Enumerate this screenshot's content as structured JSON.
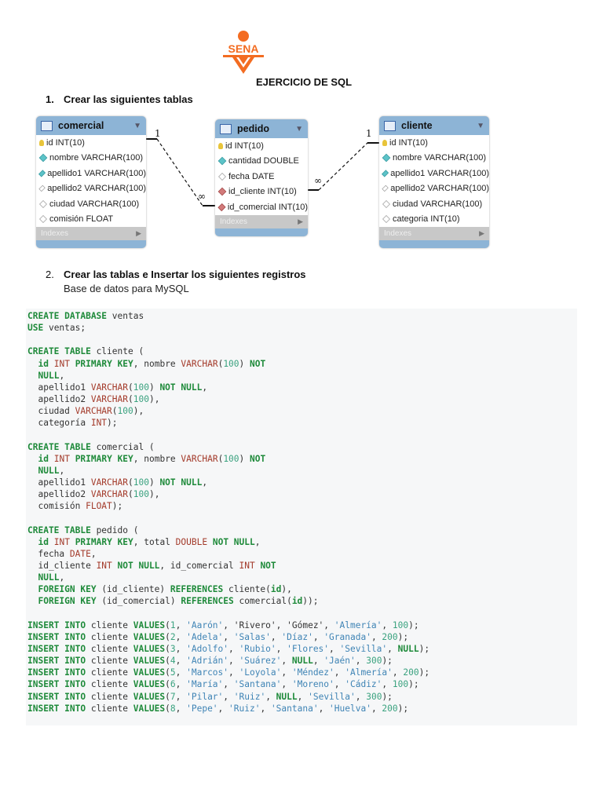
{
  "logo_text": "SENA",
  "title": "EJERCICIO DE SQL",
  "section1": {
    "num": "1.",
    "label": "Crear las siguientes tablas"
  },
  "section2": {
    "num": "2.",
    "label": "Crear las tablas e Insertar los siguientes registros",
    "subtitle": "Base de datos para MySQL"
  },
  "diagram": {
    "indexes_label": "Indexes",
    "one": "1",
    "many": "∞",
    "tables": [
      {
        "name": "comercial",
        "columns": [
          [
            "key",
            "id INT(10)"
          ],
          [
            "dia",
            "nombre VARCHAR(100)"
          ],
          [
            "dia",
            "apellido1 VARCHAR(100)"
          ],
          [
            "empty",
            "apellido2 VARCHAR(100)"
          ],
          [
            "empty",
            "ciudad VARCHAR(100)"
          ],
          [
            "empty",
            "comisión FLOAT"
          ]
        ]
      },
      {
        "name": "pedido",
        "columns": [
          [
            "key",
            "id INT(10)"
          ],
          [
            "dia",
            "cantidad DOUBLE"
          ],
          [
            "empty",
            "fecha DATE"
          ],
          [
            "fk",
            "id_cliente INT(10)"
          ],
          [
            "fk",
            "id_comercial INT(10)"
          ]
        ]
      },
      {
        "name": "cliente",
        "columns": [
          [
            "key",
            "id INT(10)"
          ],
          [
            "dia",
            "nombre VARCHAR(100)"
          ],
          [
            "dia",
            "apellido1 VARCHAR(100)"
          ],
          [
            "empty",
            "apellido2 VARCHAR(100)"
          ],
          [
            "empty",
            "ciudad VARCHAR(100)"
          ],
          [
            "empty",
            "categoria INT(10)"
          ]
        ]
      }
    ]
  },
  "code": [
    [
      [
        "k",
        "CREATE DATABASE"
      ],
      [
        "p",
        " ventas"
      ]
    ],
    [
      [
        "k",
        "USE"
      ],
      [
        "p",
        " ventas;"
      ]
    ],
    [],
    [
      [
        "k",
        "CREATE TABLE"
      ],
      [
        "p",
        " cliente ("
      ]
    ],
    [
      [
        "p",
        "  "
      ],
      [
        "k",
        "id"
      ],
      [
        "p",
        " "
      ],
      [
        "t",
        "INT"
      ],
      [
        "p",
        " "
      ],
      [
        "k",
        "PRIMARY KEY"
      ],
      [
        "p",
        ", nombre "
      ],
      [
        "t",
        "VARCHAR"
      ],
      [
        "p",
        "("
      ],
      [
        "n",
        "100"
      ],
      [
        "p",
        ") "
      ],
      [
        "k",
        "NOT"
      ]
    ],
    [
      [
        "p",
        "  "
      ],
      [
        "k",
        "NULL"
      ],
      [
        "p",
        ","
      ]
    ],
    [
      [
        "p",
        "  apellido1 "
      ],
      [
        "t",
        "VARCHAR"
      ],
      [
        "p",
        "("
      ],
      [
        "n",
        "100"
      ],
      [
        "p",
        ") "
      ],
      [
        "k",
        "NOT NULL"
      ],
      [
        "p",
        ","
      ]
    ],
    [
      [
        "p",
        "  apellido2 "
      ],
      [
        "t",
        "VARCHAR"
      ],
      [
        "p",
        "("
      ],
      [
        "n",
        "100"
      ],
      [
        "p",
        "),"
      ]
    ],
    [
      [
        "p",
        "  ciudad "
      ],
      [
        "t",
        "VARCHAR"
      ],
      [
        "p",
        "("
      ],
      [
        "n",
        "100"
      ],
      [
        "p",
        "),"
      ]
    ],
    [
      [
        "p",
        "  categoría "
      ],
      [
        "t",
        "INT"
      ],
      [
        "p",
        ");"
      ]
    ],
    [],
    [
      [
        "k",
        "CREATE TABLE"
      ],
      [
        "p",
        " comercial ("
      ]
    ],
    [
      [
        "p",
        "  "
      ],
      [
        "k",
        "id"
      ],
      [
        "p",
        " "
      ],
      [
        "t",
        "INT"
      ],
      [
        "p",
        " "
      ],
      [
        "k",
        "PRIMARY KEY"
      ],
      [
        "p",
        ", nombre "
      ],
      [
        "t",
        "VARCHAR"
      ],
      [
        "p",
        "("
      ],
      [
        "n",
        "100"
      ],
      [
        "p",
        ") "
      ],
      [
        "k",
        "NOT"
      ]
    ],
    [
      [
        "p",
        "  "
      ],
      [
        "k",
        "NULL"
      ],
      [
        "p",
        ","
      ]
    ],
    [
      [
        "p",
        "  apellido1 "
      ],
      [
        "t",
        "VARCHAR"
      ],
      [
        "p",
        "("
      ],
      [
        "n",
        "100"
      ],
      [
        "p",
        ") "
      ],
      [
        "k",
        "NOT NULL"
      ],
      [
        "p",
        ","
      ]
    ],
    [
      [
        "p",
        "  apellido2 "
      ],
      [
        "t",
        "VARCHAR"
      ],
      [
        "p",
        "("
      ],
      [
        "n",
        "100"
      ],
      [
        "p",
        "),"
      ]
    ],
    [
      [
        "p",
        "  comisión "
      ],
      [
        "t",
        "FLOAT"
      ],
      [
        "p",
        ");"
      ]
    ],
    [],
    [
      [
        "k",
        "CREATE TABLE"
      ],
      [
        "p",
        " pedido ("
      ]
    ],
    [
      [
        "p",
        "  "
      ],
      [
        "k",
        "id"
      ],
      [
        "p",
        " "
      ],
      [
        "t",
        "INT"
      ],
      [
        "p",
        " "
      ],
      [
        "k",
        "PRIMARY KEY"
      ],
      [
        "p",
        ", total "
      ],
      [
        "t",
        "DOUBLE"
      ],
      [
        "p",
        " "
      ],
      [
        "k",
        "NOT NULL"
      ],
      [
        "p",
        ","
      ]
    ],
    [
      [
        "p",
        "  fecha "
      ],
      [
        "t",
        "DATE"
      ],
      [
        "p",
        ","
      ]
    ],
    [
      [
        "p",
        "  id_cliente "
      ],
      [
        "t",
        "INT"
      ],
      [
        "p",
        " "
      ],
      [
        "k",
        "NOT NULL"
      ],
      [
        "p",
        ", id_comercial "
      ],
      [
        "t",
        "INT"
      ],
      [
        "p",
        " "
      ],
      [
        "k",
        "NOT"
      ]
    ],
    [
      [
        "p",
        "  "
      ],
      [
        "k",
        "NULL"
      ],
      [
        "p",
        ","
      ]
    ],
    [
      [
        "p",
        "  "
      ],
      [
        "k",
        "FOREIGN KEY"
      ],
      [
        "p",
        " (id_cliente) "
      ],
      [
        "k",
        "REFERENCES"
      ],
      [
        "p",
        " cliente("
      ],
      [
        "k",
        "id"
      ],
      [
        "p",
        "),"
      ]
    ],
    [
      [
        "p",
        "  "
      ],
      [
        "k",
        "FOREIGN KEY"
      ],
      [
        "p",
        " (id_comercial) "
      ],
      [
        "k",
        "REFERENCES"
      ],
      [
        "p",
        " comercial("
      ],
      [
        "k",
        "id"
      ],
      [
        "p",
        "));"
      ]
    ],
    [],
    [
      [
        "k",
        "INSERT INTO"
      ],
      [
        "p",
        " cliente "
      ],
      [
        "k",
        "VALUES"
      ],
      [
        "p",
        "("
      ],
      [
        "n",
        "1"
      ],
      [
        "p",
        ", "
      ],
      [
        "s",
        "'Aarón'"
      ],
      [
        "p",
        ", "
      ],
      [
        "p",
        "'Rivero'"
      ],
      [
        "p",
        ", "
      ],
      [
        "p",
        "'Gómez'"
      ],
      [
        "p",
        ", "
      ],
      [
        "s",
        "'Almería'"
      ],
      [
        "p",
        ", "
      ],
      [
        "n",
        "100"
      ],
      [
        "p",
        ");"
      ]
    ],
    [
      [
        "k",
        "INSERT INTO"
      ],
      [
        "p",
        " cliente "
      ],
      [
        "k",
        "VALUES"
      ],
      [
        "p",
        "("
      ],
      [
        "n",
        "2"
      ],
      [
        "p",
        ", "
      ],
      [
        "s",
        "'Adela'"
      ],
      [
        "p",
        ", "
      ],
      [
        "s",
        "'Salas'"
      ],
      [
        "p",
        ", "
      ],
      [
        "s",
        "'Díaz'"
      ],
      [
        "p",
        ", "
      ],
      [
        "s",
        "'Granada'"
      ],
      [
        "p",
        ", "
      ],
      [
        "n",
        "200"
      ],
      [
        "p",
        ");"
      ]
    ],
    [
      [
        "k",
        "INSERT INTO"
      ],
      [
        "p",
        " cliente "
      ],
      [
        "k",
        "VALUES"
      ],
      [
        "p",
        "("
      ],
      [
        "n",
        "3"
      ],
      [
        "p",
        ", "
      ],
      [
        "s",
        "'Adolfo'"
      ],
      [
        "p",
        ", "
      ],
      [
        "s",
        "'Rubio'"
      ],
      [
        "p",
        ", "
      ],
      [
        "s",
        "'Flores'"
      ],
      [
        "p",
        ", "
      ],
      [
        "s",
        "'Sevilla'"
      ],
      [
        "p",
        ", "
      ],
      [
        "k",
        "NULL"
      ],
      [
        "p",
        ");"
      ]
    ],
    [
      [
        "k",
        "INSERT INTO"
      ],
      [
        "p",
        " cliente "
      ],
      [
        "k",
        "VALUES"
      ],
      [
        "p",
        "("
      ],
      [
        "n",
        "4"
      ],
      [
        "p",
        ", "
      ],
      [
        "s",
        "'Adrián'"
      ],
      [
        "p",
        ", "
      ],
      [
        "s",
        "'Suárez'"
      ],
      [
        "p",
        ", "
      ],
      [
        "k",
        "NULL"
      ],
      [
        "p",
        ", "
      ],
      [
        "s",
        "'Jaén'"
      ],
      [
        "p",
        ", "
      ],
      [
        "n",
        "300"
      ],
      [
        "p",
        ");"
      ]
    ],
    [
      [
        "k",
        "INSERT INTO"
      ],
      [
        "p",
        " cliente "
      ],
      [
        "k",
        "VALUES"
      ],
      [
        "p",
        "("
      ],
      [
        "n",
        "5"
      ],
      [
        "p",
        ", "
      ],
      [
        "s",
        "'Marcos'"
      ],
      [
        "p",
        ", "
      ],
      [
        "s",
        "'Loyola'"
      ],
      [
        "p",
        ", "
      ],
      [
        "s",
        "'Méndez'"
      ],
      [
        "p",
        ", "
      ],
      [
        "s",
        "'Almería'"
      ],
      [
        "p",
        ", "
      ],
      [
        "n",
        "200"
      ],
      [
        "p",
        ");"
      ]
    ],
    [
      [
        "k",
        "INSERT INTO"
      ],
      [
        "p",
        " cliente "
      ],
      [
        "k",
        "VALUES"
      ],
      [
        "p",
        "("
      ],
      [
        "n",
        "6"
      ],
      [
        "p",
        ", "
      ],
      [
        "s",
        "'María'"
      ],
      [
        "p",
        ", "
      ],
      [
        "s",
        "'Santana'"
      ],
      [
        "p",
        ", "
      ],
      [
        "s",
        "'Moreno'"
      ],
      [
        "p",
        ", "
      ],
      [
        "s",
        "'Cádiz'"
      ],
      [
        "p",
        ", "
      ],
      [
        "n",
        "100"
      ],
      [
        "p",
        ");"
      ]
    ],
    [
      [
        "k",
        "INSERT INTO"
      ],
      [
        "p",
        " cliente "
      ],
      [
        "k",
        "VALUES"
      ],
      [
        "p",
        "("
      ],
      [
        "n",
        "7"
      ],
      [
        "p",
        ", "
      ],
      [
        "s",
        "'Pilar'"
      ],
      [
        "p",
        ", "
      ],
      [
        "s",
        "'Ruiz'"
      ],
      [
        "p",
        ", "
      ],
      [
        "k",
        "NULL"
      ],
      [
        "p",
        ", "
      ],
      [
        "s",
        "'Sevilla'"
      ],
      [
        "p",
        ", "
      ],
      [
        "n",
        "300"
      ],
      [
        "p",
        ");"
      ]
    ],
    [
      [
        "k",
        "INSERT INTO"
      ],
      [
        "p",
        " cliente "
      ],
      [
        "k",
        "VALUES"
      ],
      [
        "p",
        "("
      ],
      [
        "n",
        "8"
      ],
      [
        "p",
        ", "
      ],
      [
        "s",
        "'Pepe'"
      ],
      [
        "p",
        ", "
      ],
      [
        "s",
        "'Ruiz'"
      ],
      [
        "p",
        ", "
      ],
      [
        "s",
        "'Santana'"
      ],
      [
        "p",
        ", "
      ],
      [
        "s",
        "'Huelva'"
      ],
      [
        "p",
        ", "
      ],
      [
        "n",
        "200"
      ],
      [
        "p",
        ");"
      ]
    ]
  ]
}
